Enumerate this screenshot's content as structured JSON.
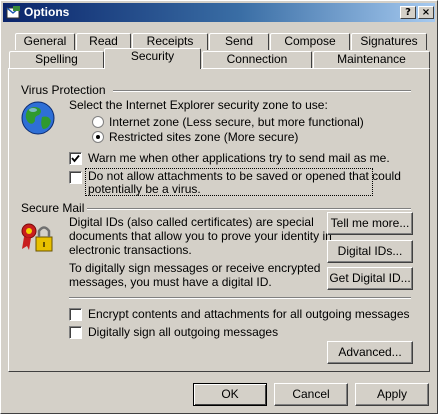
{
  "window": {
    "title": "Options",
    "help_label": "?",
    "close_label": "×"
  },
  "tabs": {
    "row1": [
      "General",
      "Read",
      "Receipts",
      "Send",
      "Compose",
      "Signatures"
    ],
    "row2": [
      "Spelling",
      "Security",
      "Connection",
      "Maintenance"
    ],
    "active": "Security"
  },
  "virus": {
    "section_label": "Virus Protection",
    "zone_prompt": "Select the Internet Explorer security zone to use:",
    "radio_internet": "Internet zone (Less secure, but more functional)",
    "radio_restricted": "Restricted sites zone (More secure)",
    "selected_zone": "Restricted sites zone (More secure)",
    "warn_label": "Warn me when other applications try to send mail as me.",
    "warn_checked": true,
    "block_line1": "Do not allow attachments to be saved or opened that could",
    "block_line2": "potentially be a virus.",
    "block_checked": false
  },
  "secure_mail": {
    "section_label": "Secure Mail",
    "desc_lines": [
      "Digital IDs (also called certificates) are special",
      "documents that allow you to prove your identity in",
      "electronic transactions."
    ],
    "sign_lines": [
      "To digitally sign messages or receive encrypted",
      "messages, you must have a digital ID."
    ],
    "tell_me_more": "Tell me more...",
    "digital_ids": "Digital IDs...",
    "get_digital_id": "Get Digital ID...",
    "encrypt_label": "Encrypt contents and attachments for all outgoing messages",
    "encrypt_checked": false,
    "sign_label": "Digitally sign all outgoing messages",
    "sign_checked": false,
    "advanced": "Advanced..."
  },
  "footer": {
    "ok": "OK",
    "cancel": "Cancel",
    "apply": "Apply"
  },
  "icons": {
    "window": "options-icon",
    "globe": "globe-icon",
    "certificate": "certificate-icon"
  }
}
